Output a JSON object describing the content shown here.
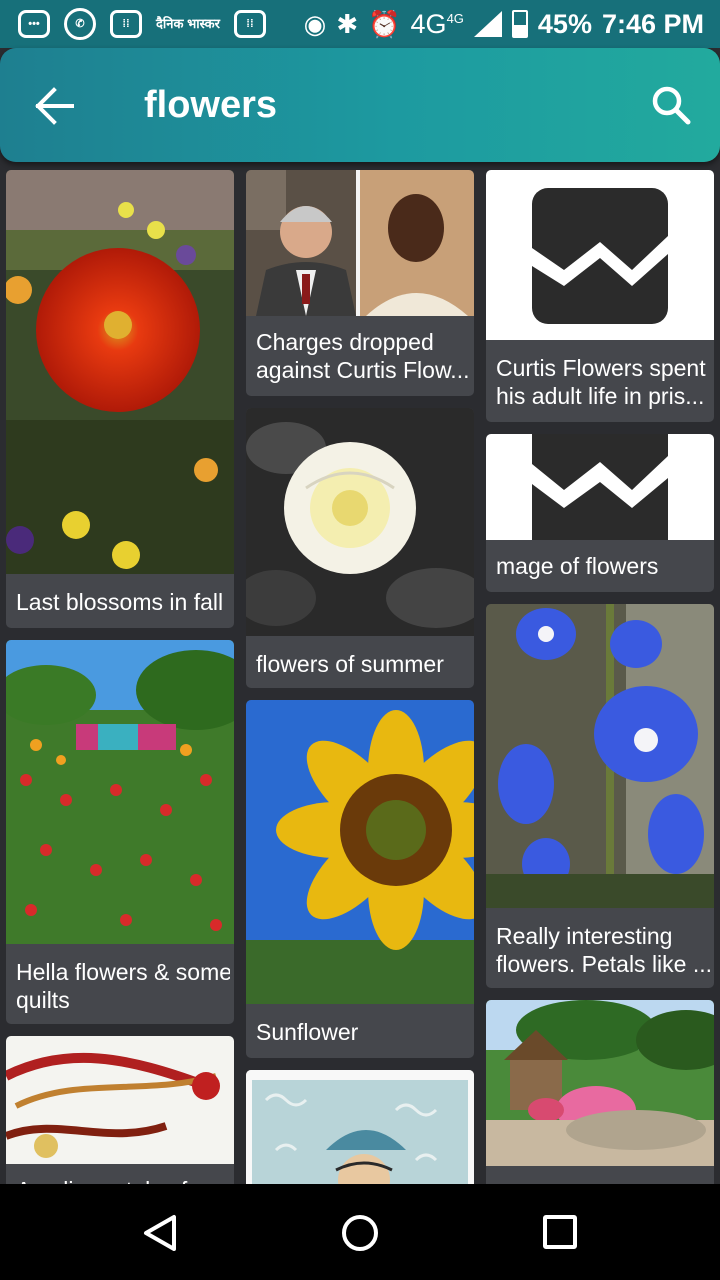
{
  "status_bar": {
    "dainik_label": "दैनिक भास्कर",
    "network": "4G",
    "network_sup": "4G",
    "battery": "45%",
    "time": "7:46 PM"
  },
  "app_bar": {
    "title": "flowers",
    "back_icon": "arrow-left-icon",
    "search_icon": "search-icon"
  },
  "cards": [
    {
      "caption": "Last blossoms in fall"
    },
    {
      "caption_lines": [
        "Hella flowers & some",
        "quilts"
      ]
    },
    {
      "caption": "Amalia portals of..."
    },
    {
      "caption_lines": [
        "Charges dropped",
        "against Curtis Flow..."
      ]
    },
    {
      "caption": "flowers of summer"
    },
    {
      "caption": "Sunflower"
    },
    {
      "caption_lines": [
        "Curtis Flowers spent",
        "his adult life in pris..."
      ]
    },
    {
      "caption": "mage of flowers"
    },
    {
      "caption_lines": [
        "Really interesting",
        "flowers. Petals like ..."
      ]
    }
  ],
  "colors": {
    "accent_start": "#1e7f90",
    "accent_end": "#22aa9e",
    "background": "#2b2c30",
    "card": "#45474c"
  }
}
